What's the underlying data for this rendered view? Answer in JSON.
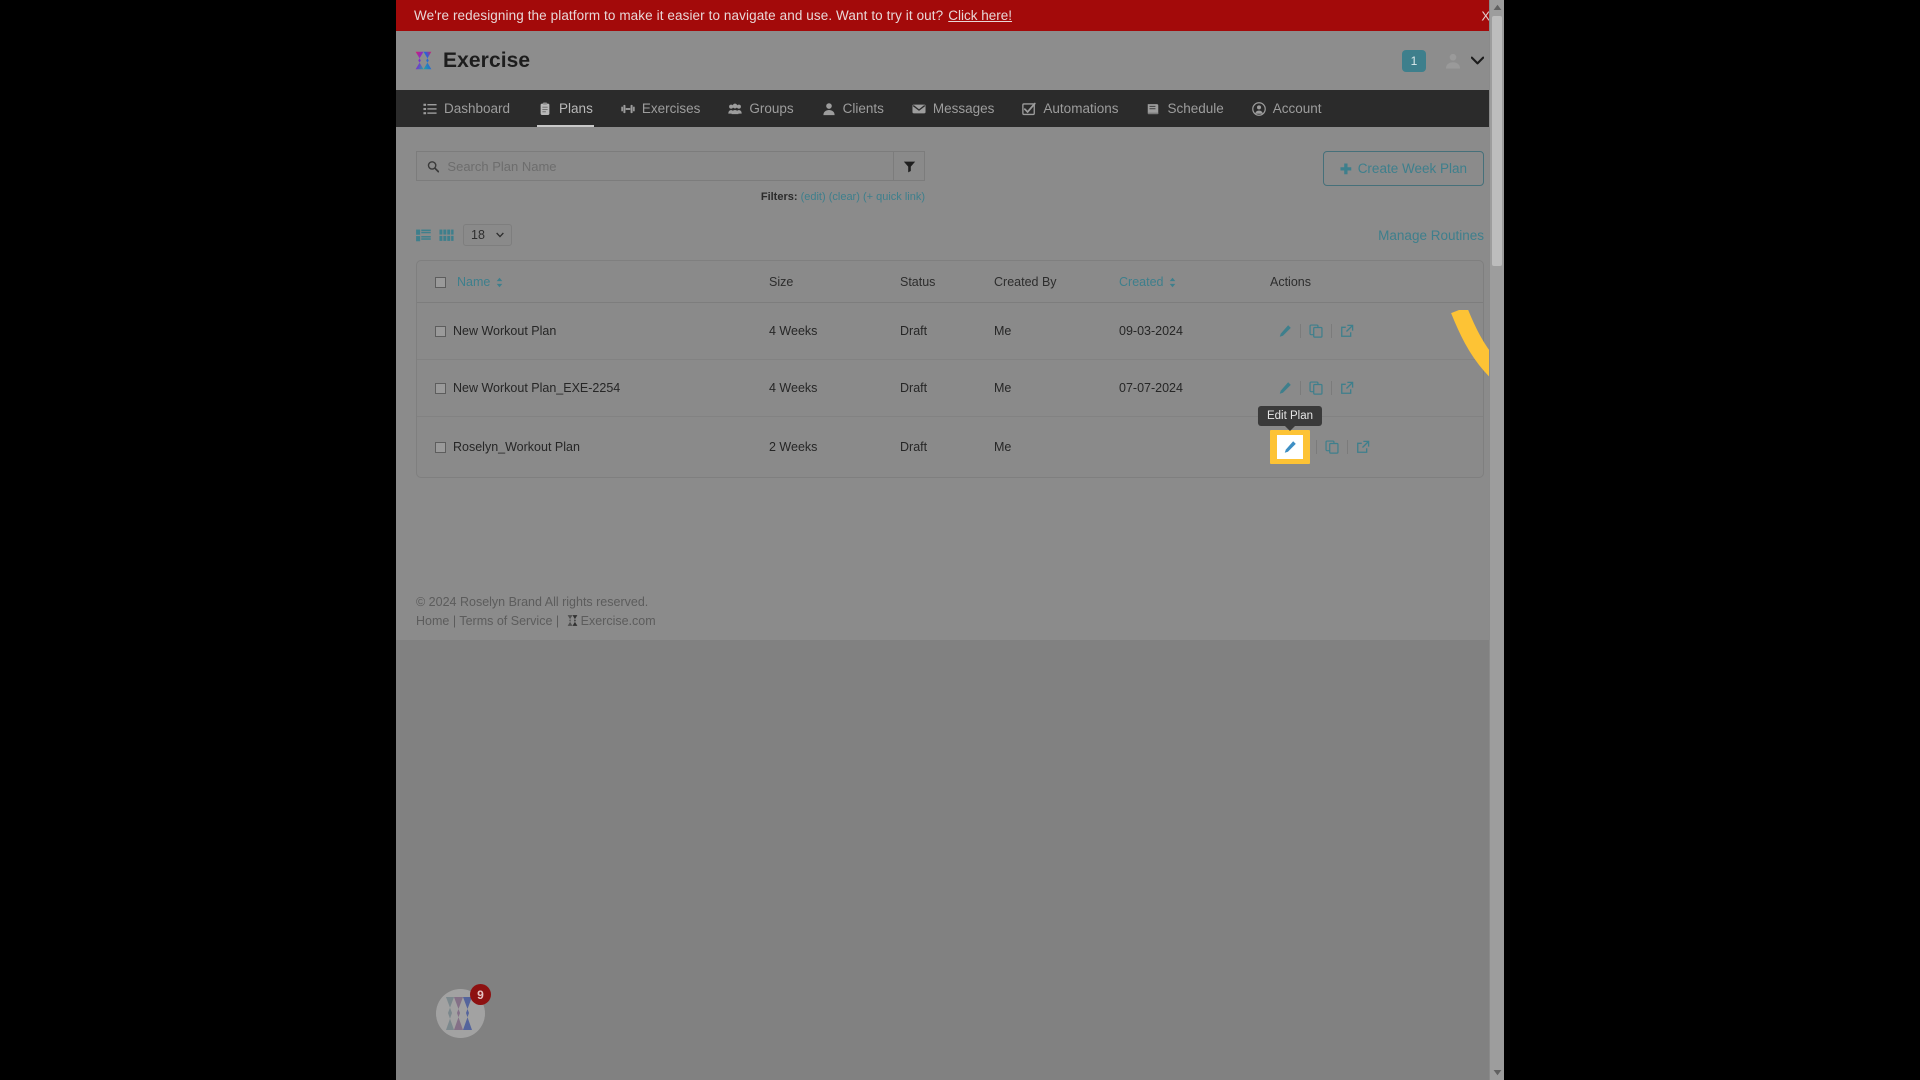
{
  "banner": {
    "text": "We're redesigning the platform to make it easier to navigate and use. Want to try it out?",
    "link": "Click here!",
    "close": "X",
    "bg_color": "#a30a0a"
  },
  "header": {
    "brand": "Exercise",
    "notification_count": "1",
    "logo_icon": "exercise-logo-icon",
    "avatar_icon": "user-avatar-icon",
    "caret_icon": "chevron-down-icon"
  },
  "nav": {
    "items": [
      {
        "label": "Dashboard",
        "icon": "list-icon",
        "active": false
      },
      {
        "label": "Plans",
        "icon": "clipboard-icon",
        "active": true
      },
      {
        "label": "Exercises",
        "icon": "dumbbell-icon",
        "active": false
      },
      {
        "label": "Groups",
        "icon": "group-icon",
        "active": false
      },
      {
        "label": "Clients",
        "icon": "person-icon",
        "active": false
      },
      {
        "label": "Messages",
        "icon": "envelope-icon",
        "active": false
      },
      {
        "label": "Automations",
        "icon": "checkbox-icon",
        "active": false
      },
      {
        "label": "Schedule",
        "icon": "calendar-book-icon",
        "active": false
      },
      {
        "label": "Account",
        "icon": "account-circle-icon",
        "active": false
      }
    ]
  },
  "toolbar": {
    "search_placeholder": "Search Plan Name",
    "search_value": "",
    "search_icon": "search-icon",
    "filter_icon": "funnel-icon",
    "filters_label": "Filters:",
    "filters_edit": "(edit)",
    "filters_clear": "(clear)",
    "filters_quicklink": "(+ quick link)",
    "create_plan_label": "Create Week Plan",
    "create_plan_plus": "✚",
    "accent_color": "#3e7f8c"
  },
  "view_controls": {
    "list_view_icon": "list-view-icon",
    "grid_view_icon": "grid-view-icon",
    "per_page_value": "18",
    "manage_routines": "Manage Routines"
  },
  "table": {
    "columns": [
      {
        "key": "name",
        "label": "Name",
        "sortable": true,
        "sorted": true
      },
      {
        "key": "size",
        "label": "Size",
        "sortable": false,
        "sorted": false
      },
      {
        "key": "status",
        "label": "Status",
        "sortable": false,
        "sorted": false
      },
      {
        "key": "created_by",
        "label": "Created By",
        "sortable": false,
        "sorted": false
      },
      {
        "key": "created",
        "label": "Created",
        "sortable": true,
        "sorted": true
      },
      {
        "key": "actions",
        "label": "Actions",
        "sortable": false,
        "sorted": false
      }
    ],
    "rows": [
      {
        "name": "New Workout Plan",
        "size": "4 Weeks",
        "status": "Draft",
        "created_by": "Me",
        "created": "09-03-2024",
        "highlighted": false
      },
      {
        "name": "New Workout Plan_EXE-2254",
        "size": "4 Weeks",
        "status": "Draft",
        "created_by": "Me",
        "created": "07-07-2024",
        "highlighted": false
      },
      {
        "name": "Roselyn_Workout Plan",
        "size": "2 Weeks",
        "status": "Draft",
        "created_by": "Me",
        "created": "",
        "highlighted": true
      }
    ],
    "action_icons": {
      "edit": "pencil-edit-icon",
      "copy": "duplicate-copy-icon",
      "open": "external-link-icon"
    }
  },
  "tooltip": {
    "text": "Edit Plan"
  },
  "annotation": {
    "arrow_color": "#fdc335",
    "highlight_color": "#fdc335"
  },
  "footer": {
    "copyright": "© 2024 Roselyn Brand All rights reserved.",
    "home": "Home",
    "terms": "Terms of Service",
    "site": "Exercise.com",
    "separator": "|"
  },
  "chat_widget": {
    "badge_count": "9",
    "icon": "chat-bubble-logo-icon"
  }
}
